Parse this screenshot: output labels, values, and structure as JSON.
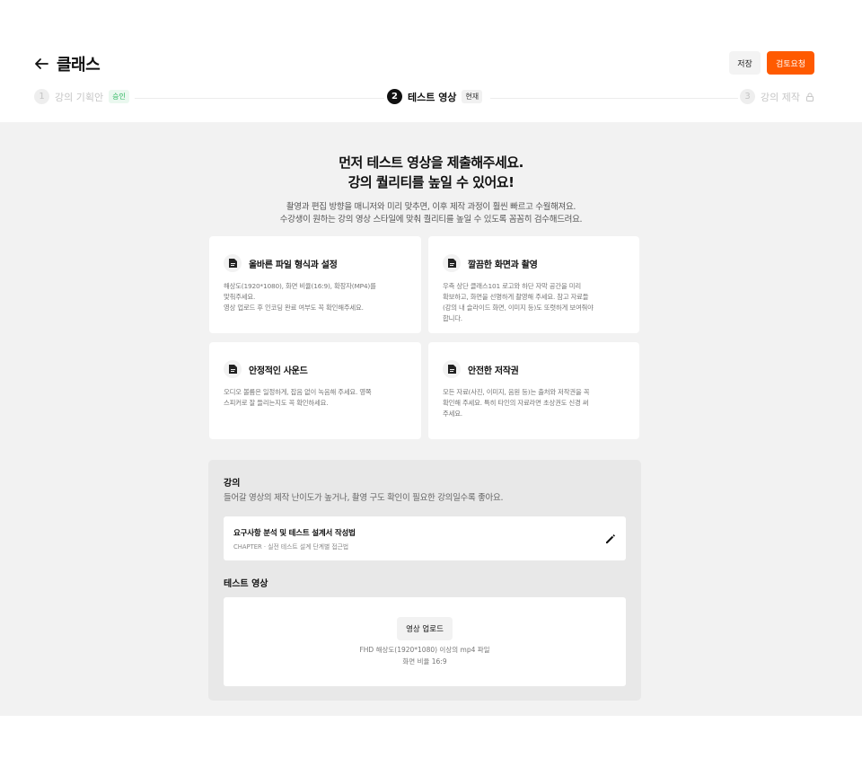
{
  "header": {
    "title": "클래스",
    "save_label": "저장",
    "review_label": "검토요청",
    "accent": "#ff5a00"
  },
  "steps": [
    {
      "num": "1",
      "label": "강의 기획안",
      "badge": "승인"
    },
    {
      "num": "2",
      "label": "테스트 영상",
      "badge": "현재"
    },
    {
      "num": "3",
      "label": "강의 제작",
      "locked": true
    }
  ],
  "main": {
    "headline_line1": "먼저 테스트 영상을 제출해주세요.",
    "headline_line2": "강의 퀄리티를 높일 수 있어요!",
    "sub_line1": "촬영과 편집 방향을 매니저와 미리 맞추면, 이후 제작 과정이 훨씬 빠르고 수월해져요.",
    "sub_line2": "수강생이 원하는 강의 영상 스타일에 맞춰 퀄리티를 높일 수 있도록 꼼꼼히 검수해드려요."
  },
  "cards": [
    {
      "title": "올바른 파일 형식과 설정",
      "line1": "해상도(1920*1080), 화면 비율(16:9), 확장자(MP4)를",
      "line2": "맞춰주세요.",
      "line3": "영상 업로드 후 인코딩 완료 여부도 꼭 확인해주세요.",
      "line4": ""
    },
    {
      "title": "깔끔한 화면과 촬영",
      "line1": "우측 상단 클래스101 로고와 하단 자막 공간을 미리",
      "line2": "확보하고, 화면을 선명하게 촬영해 주세요. 참고 자료들",
      "line3": "(강의 내 슬라이드 화면, 이미지 등)도 또렷하게 보여줘야",
      "line4": "합니다."
    },
    {
      "title": "안정적인 사운드",
      "line1": "오디오 볼륨은 일정하게, 잡음 없이 녹음해 주세요. 영쪽",
      "line2": "스피커로 잘 들리는지도 꼭 확인하세요.",
      "line3": "",
      "line4": ""
    },
    {
      "title": "안전한 저작권",
      "line1": "모든 자료(사진, 이미지, 음원 등)는 출처와 저작권을 꼭",
      "line2": "확인해 주세요. 특히 타인의 자료라면 초상권도 신경 써",
      "line3": "주세요.",
      "line4": ""
    }
  ],
  "lecture": {
    "label": "강의",
    "description": "들어갈 영상의 제작 난이도가 높거나, 촬영 구도 확인이 필요한 강의일수록 좋아요.",
    "chapter_title": "요구사항 분석 및 테스트 설계서 작성법",
    "chapter_sub": "CHAPTER · 실전 테스트 설계 단계별 접근법"
  },
  "test_video": {
    "label": "테스트 영상",
    "upload_label": "영상 업로드",
    "hint1": "FHD 해상도(1920*1080) 이상의 mp4 파일",
    "hint2": "화면 비율 16:9"
  }
}
